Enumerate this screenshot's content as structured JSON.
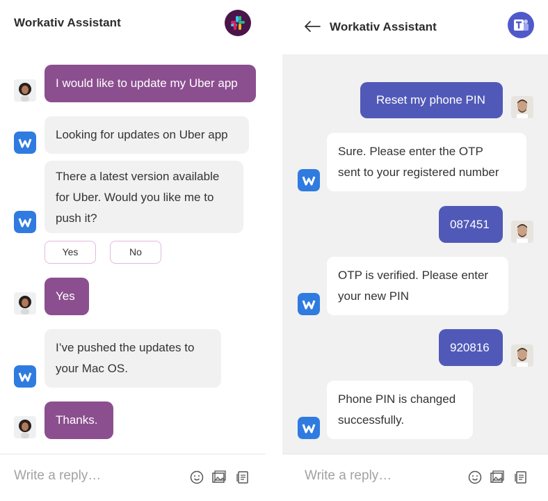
{
  "left": {
    "title": "Workativ Assistant",
    "app_icon": "slack-icon",
    "messages": [
      {
        "from": "user",
        "text": "I would like to update my Uber app"
      },
      {
        "from": "bot",
        "text": "Looking for updates on Uber app"
      },
      {
        "from": "bot",
        "lines": [
          "There a latest version available",
          "for Uber. Would you like me to",
          "push it?"
        ]
      },
      {
        "from": "user",
        "text": "Yes"
      },
      {
        "from": "bot",
        "lines": [
          "I’ve pushed the updates to",
          "your Mac OS."
        ]
      },
      {
        "from": "user",
        "text": "Thanks."
      }
    ],
    "quick_replies": [
      "Yes",
      "No"
    ],
    "composer_placeholder": "Write a reply…"
  },
  "right": {
    "title": "Workativ Assistant",
    "app_icon": "teams-icon",
    "messages": [
      {
        "from": "user",
        "text": "Reset my phone PIN"
      },
      {
        "from": "bot",
        "lines": [
          "Sure. Please enter the OTP",
          "sent to your registered number"
        ]
      },
      {
        "from": "user",
        "text": "087451"
      },
      {
        "from": "bot",
        "lines": [
          "OTP is verified. Please enter",
          "your new PIN"
        ]
      },
      {
        "from": "user",
        "text": "920816"
      },
      {
        "from": "bot",
        "lines": [
          "Phone PIN is changed",
          "successfully."
        ]
      }
    ],
    "composer_placeholder": "Write a reply…"
  },
  "colors": {
    "left_user_bubble": "#8b4f8f",
    "right_user_bubble": "#5159b8",
    "bot_bubble": "#f1f1f1",
    "slack_bg": "#4a154b",
    "teams_bg": "#5059c9",
    "bot_avatar": "#2f7be0"
  },
  "icons": [
    "emoji-icon",
    "image-icon",
    "attachment-icon",
    "back-arrow-icon"
  ]
}
